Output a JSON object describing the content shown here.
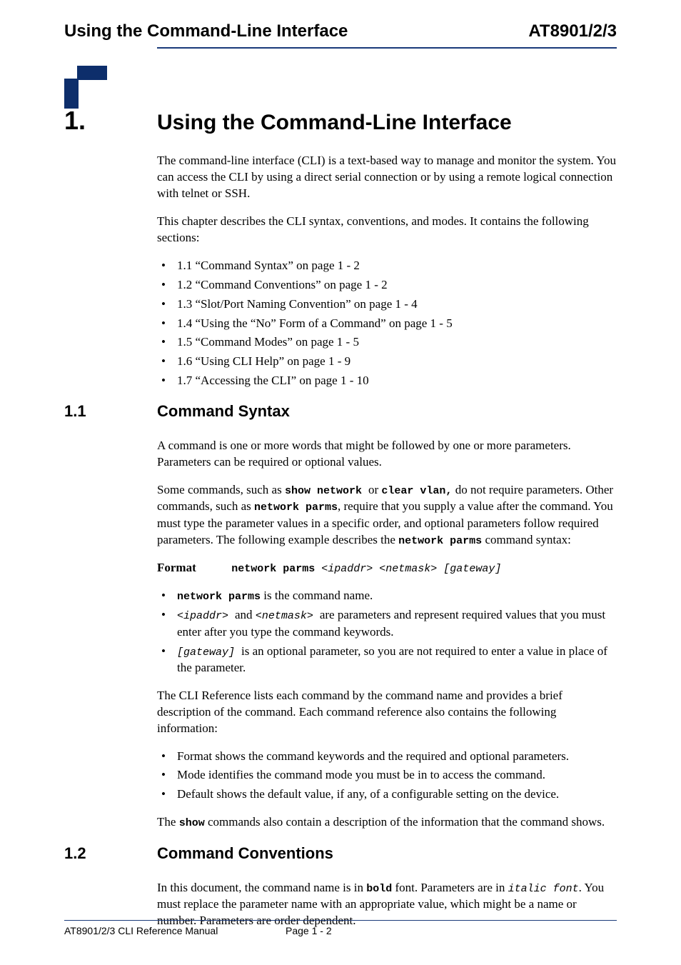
{
  "header": {
    "left": "Using the Command-Line Interface",
    "right": "AT8901/2/3"
  },
  "chapter": {
    "number": "1.",
    "title": "Using the Command-Line Interface",
    "intro1": "The command-line interface (CLI) is a text-based way to manage and monitor the system. You can access the CLI by using a direct serial connection or by using a remote logical connection with telnet or SSH.",
    "intro2": "This chapter describes the CLI syntax, conventions, and modes. It contains the following sections:",
    "toc": [
      "1.1 “Command Syntax” on page 1 - 2",
      "1.2 “Command Conventions” on page 1 - 2",
      "1.3 “Slot/Port Naming Convention” on page 1 - 4",
      "1.4 “Using the “No” Form of a Command” on page 1 - 5",
      "1.5 “Command Modes” on page 1 - 5",
      "1.6 “Using CLI Help” on page 1 - 9",
      "1.7 “Accessing the CLI” on page 1 - 10"
    ]
  },
  "s11": {
    "number": "1.1",
    "title": "Command Syntax",
    "p1": "A command is one or more words that might be followed by one or more parameters. Parameters can be required or optional values.",
    "p2a": "Some commands, such as ",
    "p2cmd1": "show network ",
    "p2or": "or ",
    "p2cmd2": "clear vlan,",
    "p2b": " do not require parameters. Other commands, such as ",
    "p2cmd3": "network parms",
    "p2c": ", require that you supply a value after the command. You must type the parameter values in a specific order, and optional parameters follow required parameters. The following example describes the ",
    "p2cmd4": "network parms",
    "p2d": " command syntax:",
    "format_label": "Format",
    "format_cmd": "network parms ",
    "format_args": "<ipaddr> <netmask> [gateway]",
    "b1_cmd": "network parms",
    "b1_rest": " is the command name.",
    "b2_arg1": "<ipaddr> ",
    "b2_and": "and ",
    "b2_arg2": "<netmask> ",
    "b2_rest": "are parameters and represent required values that you must enter after you type the command keywords.",
    "b3_arg": "[gateway] ",
    "b3_rest": "is an optional parameter, so you are not required to enter a value in place of the parameter.",
    "p3": "The CLI Reference lists each command by the command name and provides a brief description of the command. Each command reference also contains the following information:",
    "info_bullets": [
      "Format shows the command keywords and the required and optional parameters.",
      "Mode identifies the command mode you must be in to access the command.",
      "Default shows the default value, if any, of a configurable setting on the device."
    ],
    "p4a": "The ",
    "p4cmd": "show",
    "p4b": " commands also contain a description of the information that the command shows."
  },
  "s12": {
    "number": "1.2",
    "title": "Command Conventions",
    "p1a": "In this document, the command name is in ",
    "p1bold": "bold",
    "p1b": " font. Parameters are in ",
    "p1ital": "italic font",
    "p1c": ". You must replace the parameter name with an appropriate value, which might be a name or number. Parameters are order dependent."
  },
  "footer": {
    "manual": "AT8901/2/3 CLI Reference Manual",
    "page": "Page 1 - 2"
  }
}
